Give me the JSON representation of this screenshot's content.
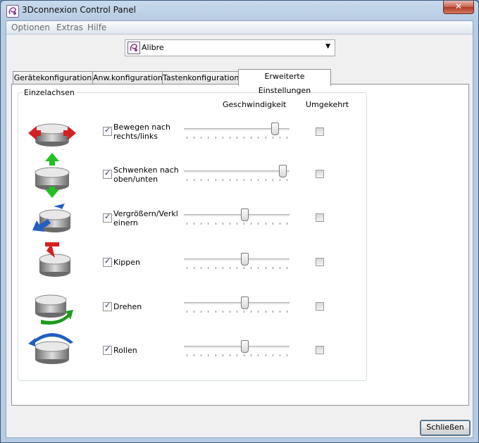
{
  "window": {
    "title": "3Dconnexion Control Panel",
    "close_glyph": "✕"
  },
  "menu": {
    "items": [
      {
        "label": "Optionen"
      },
      {
        "label": "Extras"
      },
      {
        "label": "Hilfe"
      }
    ]
  },
  "app_selector": {
    "value": "Alibre",
    "arrow": "▼"
  },
  "tabs": [
    {
      "label": "Gerätekonfiguration",
      "active": false
    },
    {
      "label": "Anw.konfiguration",
      "active": false
    },
    {
      "label": "Tastenkonfiguration",
      "active": false
    },
    {
      "label": "Erweiterte Einstellungen",
      "active": true
    }
  ],
  "group": {
    "label": "Einzelachsen",
    "speed_header": "Geschwindigkeit",
    "invert_header": "Umgekehrt"
  },
  "axes": [
    {
      "label": "Bewegen nach rechts/links",
      "enabled": true,
      "speed": 0.89,
      "inverted": false,
      "icon": "pan-left-right-icon"
    },
    {
      "label": "Schwenken nach oben/unten",
      "enabled": true,
      "speed": 0.97,
      "inverted": false,
      "icon": "pan-up-down-icon"
    },
    {
      "label": "Vergrößern/Verkleinern",
      "enabled": true,
      "speed": 0.58,
      "inverted": false,
      "icon": "zoom-icon"
    },
    {
      "label": "Kippen",
      "enabled": true,
      "speed": 0.58,
      "inverted": false,
      "icon": "tilt-icon"
    },
    {
      "label": "Drehen",
      "enabled": true,
      "speed": 0.58,
      "inverted": false,
      "icon": "spin-icon"
    },
    {
      "label": "Rollen",
      "enabled": true,
      "speed": 0.58,
      "inverted": false,
      "icon": "roll-icon"
    }
  ],
  "check_glyph": "✓",
  "footer": {
    "close_label": "Schließen"
  },
  "colors": {
    "red_arrow": "#d42020",
    "green_arrow": "#22c022",
    "blue_arrow": "#2060c0",
    "green_spin": "#1e9a1e"
  }
}
